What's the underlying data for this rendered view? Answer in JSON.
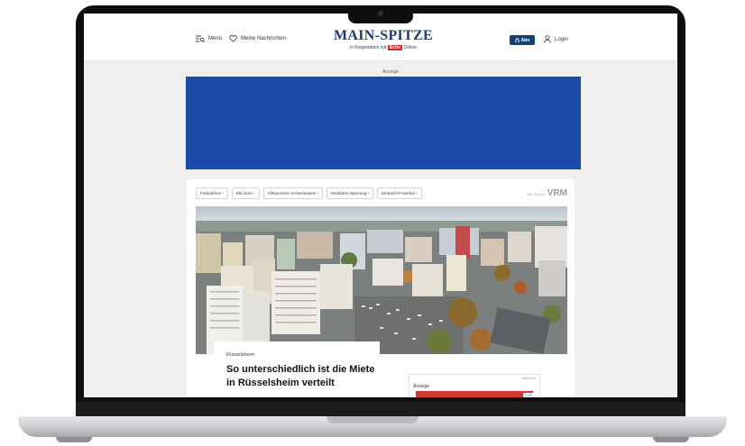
{
  "header": {
    "menu_label": "Menü",
    "saved_label": "Meine Nachrichten",
    "logo_title": "MAIN-SPITZE",
    "logo_sub_prefix": "in Kooperation mit",
    "logo_sub_brand": "Echo",
    "logo_sub_suffix": "Online",
    "abo_label": "Abo",
    "login_label": "Login"
  },
  "ad": {
    "label": "Anzeige"
  },
  "topics": [
    "Fußball live",
    "EM 2024",
    "Afrikanische Schweinepest",
    "Riedbahn-Sperrung",
    "Eintracht Frankfurt"
  ],
  "brand": {
    "prefix": "Ein Teil von",
    "name": "VRM"
  },
  "article": {
    "kicker": "Rüsselsheim",
    "headline": "So unterschiedlich ist die Miete in Rüsselsheim verteilt"
  },
  "side_ad": {
    "label": "Anzeige",
    "tag": "ANZEIGE"
  },
  "colors": {
    "brand_blue": "#123f78",
    "ad_blue": "#1a4ca9",
    "echo_red": "#d9262e"
  }
}
